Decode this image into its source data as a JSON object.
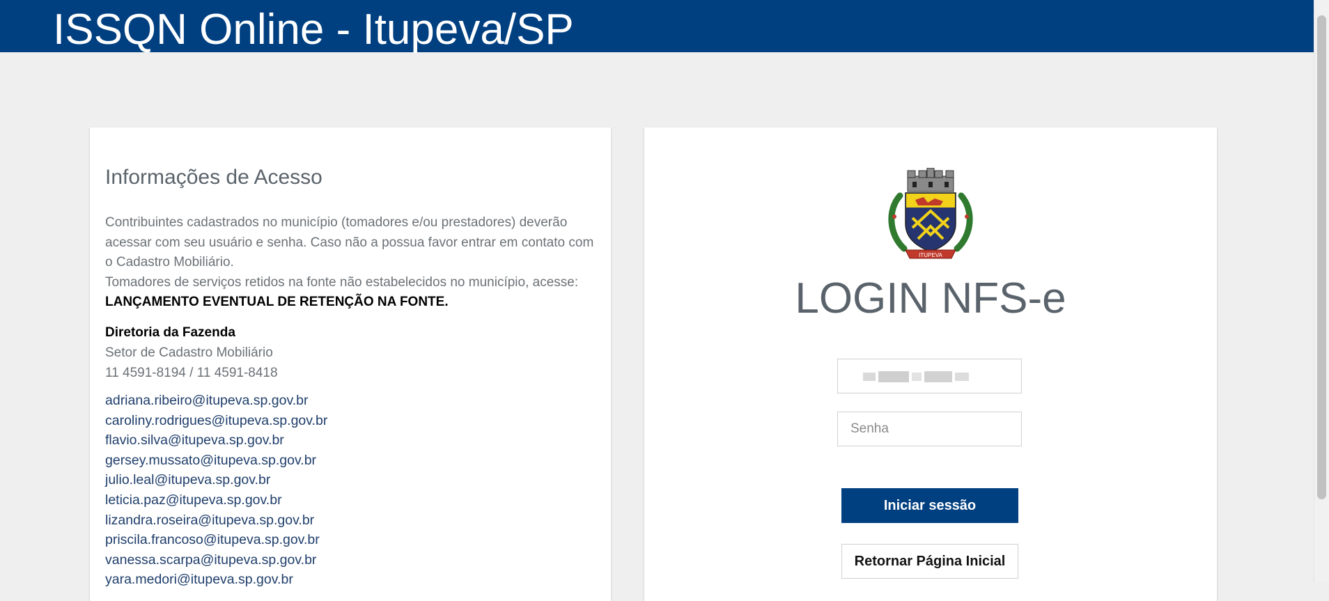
{
  "header": {
    "title": "ISSQN Online - Itupeva/SP"
  },
  "info": {
    "heading": "Informações de Acesso",
    "paragraph_1": "Contribuintes cadastrados no município (tomadores e/ou prestadores) deverão acessar com seu usuário e senha. Caso não a possua favor entrar em contato com o Cadastro Mobiliário.",
    "paragraph_2": "Tomadores de serviços retidos na fonte não estabelecidos no município, acesse: ",
    "paragraph_2_link": "LANÇAMENTO EVENTUAL DE RETENÇÃO NA FONTE.",
    "department": "Diretoria da Fazenda",
    "sector": "Setor de Cadastro Mobiliário",
    "phones": "11 4591-8194 / 11 4591-8418",
    "emails": [
      "adriana.ribeiro@itupeva.sp.gov.br",
      "caroliny.rodrigues@itupeva.sp.gov.br",
      "flavio.silva@itupeva.sp.gov.br",
      "gersey.mussato@itupeva.sp.gov.br",
      "julio.leal@itupeva.sp.gov.br",
      "leticia.paz@itupeva.sp.gov.br",
      "lizandra.roseira@itupeva.sp.gov.br",
      "priscila.francoso@itupeva.sp.gov.br",
      "vanessa.scarpa@itupeva.sp.gov.br",
      "yara.medori@itupeva.sp.gov.br"
    ]
  },
  "login": {
    "crest_icon": "itupeva-coat-of-arms-icon",
    "crest_label": "ITUPEVA",
    "title": "LOGIN NFS-e",
    "username_value": "",
    "password_placeholder": "Senha",
    "submit_label": "Iniciar sessão",
    "back_label": "Retornar Página Inicial"
  },
  "colors": {
    "header_bg": "#003f80",
    "page_bg": "#efefef",
    "link": "#1f3e6b",
    "primary_button": "#003f80"
  }
}
